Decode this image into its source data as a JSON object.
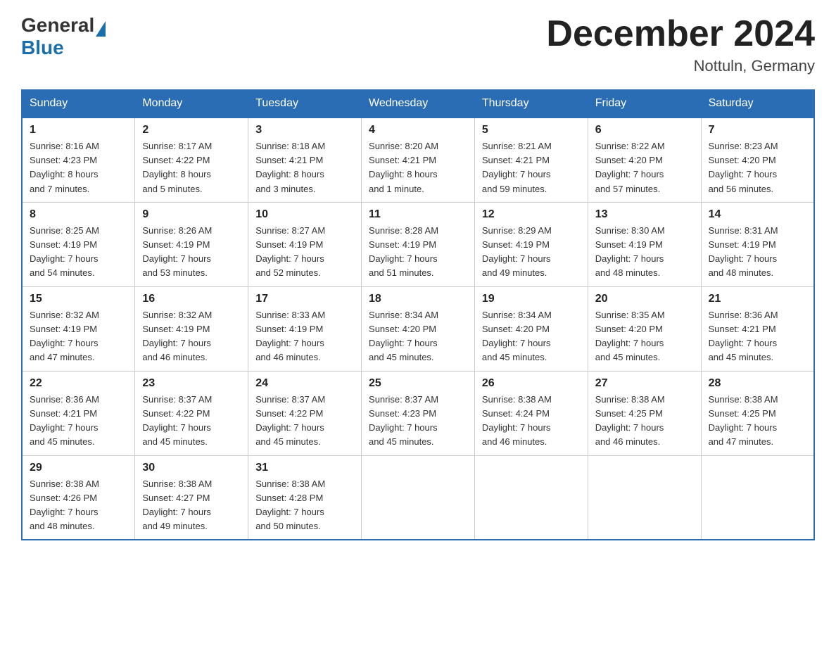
{
  "header": {
    "logo": {
      "general": "General",
      "blue": "Blue"
    },
    "title": "December 2024",
    "location": "Nottuln, Germany"
  },
  "calendar": {
    "days_of_week": [
      "Sunday",
      "Monday",
      "Tuesday",
      "Wednesday",
      "Thursday",
      "Friday",
      "Saturday"
    ],
    "weeks": [
      [
        {
          "day": "1",
          "sunrise": "8:16 AM",
          "sunset": "4:23 PM",
          "daylight": "8 hours and 7 minutes."
        },
        {
          "day": "2",
          "sunrise": "8:17 AM",
          "sunset": "4:22 PM",
          "daylight": "8 hours and 5 minutes."
        },
        {
          "day": "3",
          "sunrise": "8:18 AM",
          "sunset": "4:21 PM",
          "daylight": "8 hours and 3 minutes."
        },
        {
          "day": "4",
          "sunrise": "8:20 AM",
          "sunset": "4:21 PM",
          "daylight": "8 hours and 1 minute."
        },
        {
          "day": "5",
          "sunrise": "8:21 AM",
          "sunset": "4:21 PM",
          "daylight": "7 hours and 59 minutes."
        },
        {
          "day": "6",
          "sunrise": "8:22 AM",
          "sunset": "4:20 PM",
          "daylight": "7 hours and 57 minutes."
        },
        {
          "day": "7",
          "sunrise": "8:23 AM",
          "sunset": "4:20 PM",
          "daylight": "7 hours and 56 minutes."
        }
      ],
      [
        {
          "day": "8",
          "sunrise": "8:25 AM",
          "sunset": "4:19 PM",
          "daylight": "7 hours and 54 minutes."
        },
        {
          "day": "9",
          "sunrise": "8:26 AM",
          "sunset": "4:19 PM",
          "daylight": "7 hours and 53 minutes."
        },
        {
          "day": "10",
          "sunrise": "8:27 AM",
          "sunset": "4:19 PM",
          "daylight": "7 hours and 52 minutes."
        },
        {
          "day": "11",
          "sunrise": "8:28 AM",
          "sunset": "4:19 PM",
          "daylight": "7 hours and 51 minutes."
        },
        {
          "day": "12",
          "sunrise": "8:29 AM",
          "sunset": "4:19 PM",
          "daylight": "7 hours and 49 minutes."
        },
        {
          "day": "13",
          "sunrise": "8:30 AM",
          "sunset": "4:19 PM",
          "daylight": "7 hours and 48 minutes."
        },
        {
          "day": "14",
          "sunrise": "8:31 AM",
          "sunset": "4:19 PM",
          "daylight": "7 hours and 48 minutes."
        }
      ],
      [
        {
          "day": "15",
          "sunrise": "8:32 AM",
          "sunset": "4:19 PM",
          "daylight": "7 hours and 47 minutes."
        },
        {
          "day": "16",
          "sunrise": "8:32 AM",
          "sunset": "4:19 PM",
          "daylight": "7 hours and 46 minutes."
        },
        {
          "day": "17",
          "sunrise": "8:33 AM",
          "sunset": "4:19 PM",
          "daylight": "7 hours and 46 minutes."
        },
        {
          "day": "18",
          "sunrise": "8:34 AM",
          "sunset": "4:20 PM",
          "daylight": "7 hours and 45 minutes."
        },
        {
          "day": "19",
          "sunrise": "8:34 AM",
          "sunset": "4:20 PM",
          "daylight": "7 hours and 45 minutes."
        },
        {
          "day": "20",
          "sunrise": "8:35 AM",
          "sunset": "4:20 PM",
          "daylight": "7 hours and 45 minutes."
        },
        {
          "day": "21",
          "sunrise": "8:36 AM",
          "sunset": "4:21 PM",
          "daylight": "7 hours and 45 minutes."
        }
      ],
      [
        {
          "day": "22",
          "sunrise": "8:36 AM",
          "sunset": "4:21 PM",
          "daylight": "7 hours and 45 minutes."
        },
        {
          "day": "23",
          "sunrise": "8:37 AM",
          "sunset": "4:22 PM",
          "daylight": "7 hours and 45 minutes."
        },
        {
          "day": "24",
          "sunrise": "8:37 AM",
          "sunset": "4:22 PM",
          "daylight": "7 hours and 45 minutes."
        },
        {
          "day": "25",
          "sunrise": "8:37 AM",
          "sunset": "4:23 PM",
          "daylight": "7 hours and 45 minutes."
        },
        {
          "day": "26",
          "sunrise": "8:38 AM",
          "sunset": "4:24 PM",
          "daylight": "7 hours and 46 minutes."
        },
        {
          "day": "27",
          "sunrise": "8:38 AM",
          "sunset": "4:25 PM",
          "daylight": "7 hours and 46 minutes."
        },
        {
          "day": "28",
          "sunrise": "8:38 AM",
          "sunset": "4:25 PM",
          "daylight": "7 hours and 47 minutes."
        }
      ],
      [
        {
          "day": "29",
          "sunrise": "8:38 AM",
          "sunset": "4:26 PM",
          "daylight": "7 hours and 48 minutes."
        },
        {
          "day": "30",
          "sunrise": "8:38 AM",
          "sunset": "4:27 PM",
          "daylight": "7 hours and 49 minutes."
        },
        {
          "day": "31",
          "sunrise": "8:38 AM",
          "sunset": "4:28 PM",
          "daylight": "7 hours and 50 minutes."
        },
        null,
        null,
        null,
        null
      ]
    ]
  }
}
